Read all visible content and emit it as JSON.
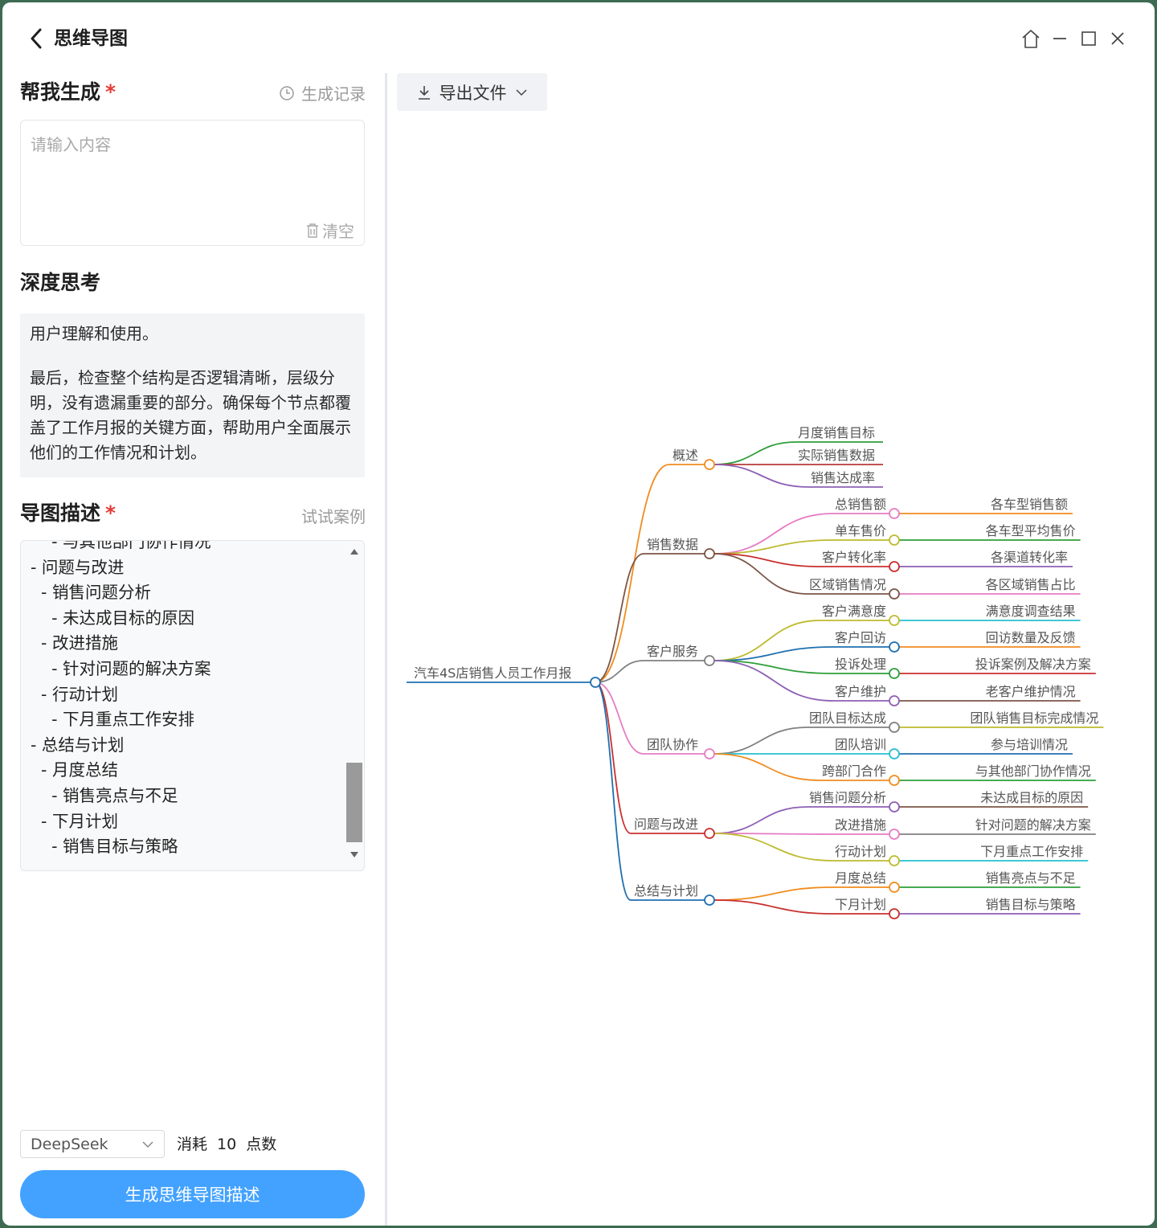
{
  "app": {
    "title": "思维导图"
  },
  "generate": {
    "title": "帮我生成",
    "required_mark": "*",
    "history_label": "生成记录",
    "input_placeholder": "请输入内容",
    "input_value": "",
    "clear_label": "清空"
  },
  "thinking": {
    "title": "深度思考",
    "paragraphs": [
      "用户理解和使用。",
      "最后，检查整个结构是否逻辑清晰，层级分明，没有遗漏重要的部分。确保每个节点都覆盖了工作月报的关键方面，帮助用户全面展示他们的工作情况和计划。"
    ]
  },
  "description": {
    "title": "导图描述",
    "required_mark": "*",
    "try_case_label": "试试案例",
    "lines": [
      "    - 与其他部门协作情况",
      "- 问题与改进",
      "  - 销售问题分析",
      "    - 未达成目标的原因",
      "  - 改进措施",
      "    - 针对问题的解决方案",
      "  - 行动计划",
      "    - 下月重点工作安排",
      "- 总结与计划",
      "  - 月度总结",
      "    - 销售亮点与不足",
      "  - 下月计划",
      "    - 销售目标与策略"
    ]
  },
  "footer": {
    "model": "DeepSeek",
    "cost_prefix": "消耗",
    "cost_value": "10",
    "cost_suffix": "点数",
    "generate_button": "生成思维导图描述"
  },
  "toolbar": {
    "export_label": "导出文件"
  },
  "mindmap": {
    "root": "汽车4S店销售人员工作月报",
    "root_color": "#1f6fb0",
    "branches": [
      {
        "label": "概述",
        "color": "#f08c1f",
        "children": [
          {
            "label": "月度销售目标",
            "color": "#2e9e3a",
            "children": []
          },
          {
            "label": "实际销售数据",
            "color": "#b83a3a",
            "children": []
          },
          {
            "label": "销售达成率",
            "color": "#8e5fb5",
            "children": []
          }
        ]
      },
      {
        "label": "销售数据",
        "color": "#7b5546",
        "children": [
          {
            "label": "总销售额",
            "color": "#e57cc3",
            "children": [
              {
                "label": "各车型销售额",
                "color": "#f08c1f"
              }
            ]
          },
          {
            "label": "单车售价",
            "color": "#bdbb2e",
            "children": [
              {
                "label": "各车型平均售价",
                "color": "#2e9e3a"
              }
            ]
          },
          {
            "label": "客户转化率",
            "color": "#c8302f",
            "children": [
              {
                "label": "各渠道转化率",
                "color": "#8e5fb5"
              }
            ]
          },
          {
            "label": "区域销售情况",
            "color": "#7b5546",
            "children": [
              {
                "label": "各区域销售占比",
                "color": "#e57cc3"
              }
            ]
          }
        ]
      },
      {
        "label": "客户服务",
        "color": "#808080",
        "children": [
          {
            "label": "客户满意度",
            "color": "#bdbb2e",
            "children": [
              {
                "label": "满意度调查结果",
                "color": "#26bfd0"
              }
            ]
          },
          {
            "label": "客户回访",
            "color": "#1f6fb0",
            "children": [
              {
                "label": "回访数量及反馈",
                "color": "#f08c1f"
              }
            ]
          },
          {
            "label": "投诉处理",
            "color": "#2e9e3a",
            "children": [
              {
                "label": "投诉案例及解决方案",
                "color": "#c8302f"
              }
            ]
          },
          {
            "label": "客户维护",
            "color": "#8e5fb5",
            "children": [
              {
                "label": "老客户维护情况",
                "color": "#7b5546"
              }
            ]
          }
        ]
      },
      {
        "label": "团队协作",
        "color": "#e57cc3",
        "children": [
          {
            "label": "团队目标达成",
            "color": "#808080",
            "children": [
              {
                "label": "团队销售目标完成情况",
                "color": "#bdbb2e"
              }
            ]
          },
          {
            "label": "团队培训",
            "color": "#26bfd0",
            "children": [
              {
                "label": "参与培训情况",
                "color": "#1f6fb0"
              }
            ]
          },
          {
            "label": "跨部门合作",
            "color": "#f08c1f",
            "children": [
              {
                "label": "与其他部门协作情况",
                "color": "#2e9e3a"
              }
            ]
          }
        ]
      },
      {
        "label": "问题与改进",
        "color": "#c8302f",
        "children": [
          {
            "label": "销售问题分析",
            "color": "#8e5fb5",
            "children": [
              {
                "label": "未达成目标的原因",
                "color": "#7b5546"
              }
            ]
          },
          {
            "label": "改进措施",
            "color": "#e57cc3",
            "children": [
              {
                "label": "针对问题的解决方案",
                "color": "#808080"
              }
            ]
          },
          {
            "label": "行动计划",
            "color": "#bdbb2e",
            "children": [
              {
                "label": "下月重点工作安排",
                "color": "#26bfd0"
              }
            ]
          }
        ]
      },
      {
        "label": "总结与计划",
        "color": "#1f6fb0",
        "children": [
          {
            "label": "月度总结",
            "color": "#f08c1f",
            "children": [
              {
                "label": "销售亮点与不足",
                "color": "#2e9e3a"
              }
            ]
          },
          {
            "label": "下月计划",
            "color": "#c8302f",
            "children": [
              {
                "label": "销售目标与策略",
                "color": "#8e5fb5"
              }
            ]
          }
        ]
      }
    ]
  }
}
